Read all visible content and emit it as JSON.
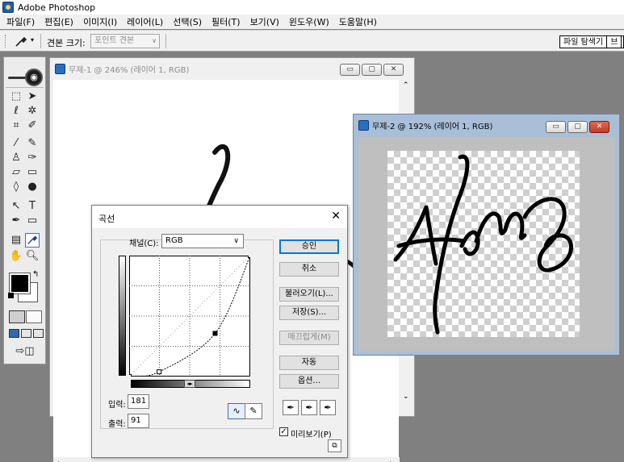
{
  "app": {
    "title": "Adobe Photoshop"
  },
  "menu": [
    "파일(F)",
    "편집(E)",
    "이미지(I)",
    "레이어(L)",
    "선택(S)",
    "필터(T)",
    "보기(V)",
    "윈도우(W)",
    "도움말(H)"
  ],
  "options_bar": {
    "sample_size_label": "견본 크기:",
    "sample_size_value": "포인트 견본",
    "palette_tabs": [
      "파일 탐색기",
      "브"
    ]
  },
  "doc1": {
    "title": "무제-1 @ 246% (레이어 1, RGB)"
  },
  "doc2": {
    "title": "무제-2 @ 192% (레이어 1, RGB)"
  },
  "curves": {
    "title": "곡선",
    "channel_label": "채널(C):",
    "channel_value": "RGB",
    "input_label": "입력:",
    "input_value": "181",
    "output_label": "출력:",
    "output_value": "91",
    "buttons": {
      "ok": "승인",
      "cancel": "취소",
      "load": "불러오기(L)...",
      "save": "저장(S)...",
      "smooth": "매끄럽게(M)",
      "auto": "자동",
      "options": "옵션..."
    },
    "preview_label": "미리보기(P)",
    "preview_checked": true,
    "curve_points": [
      [
        0,
        0
      ],
      [
        63,
        10
      ],
      [
        181,
        91
      ],
      [
        255,
        255
      ]
    ]
  },
  "colors": {
    "foreground": "#000000",
    "background": "#ffffff",
    "default_button_border": "#0078d7"
  }
}
